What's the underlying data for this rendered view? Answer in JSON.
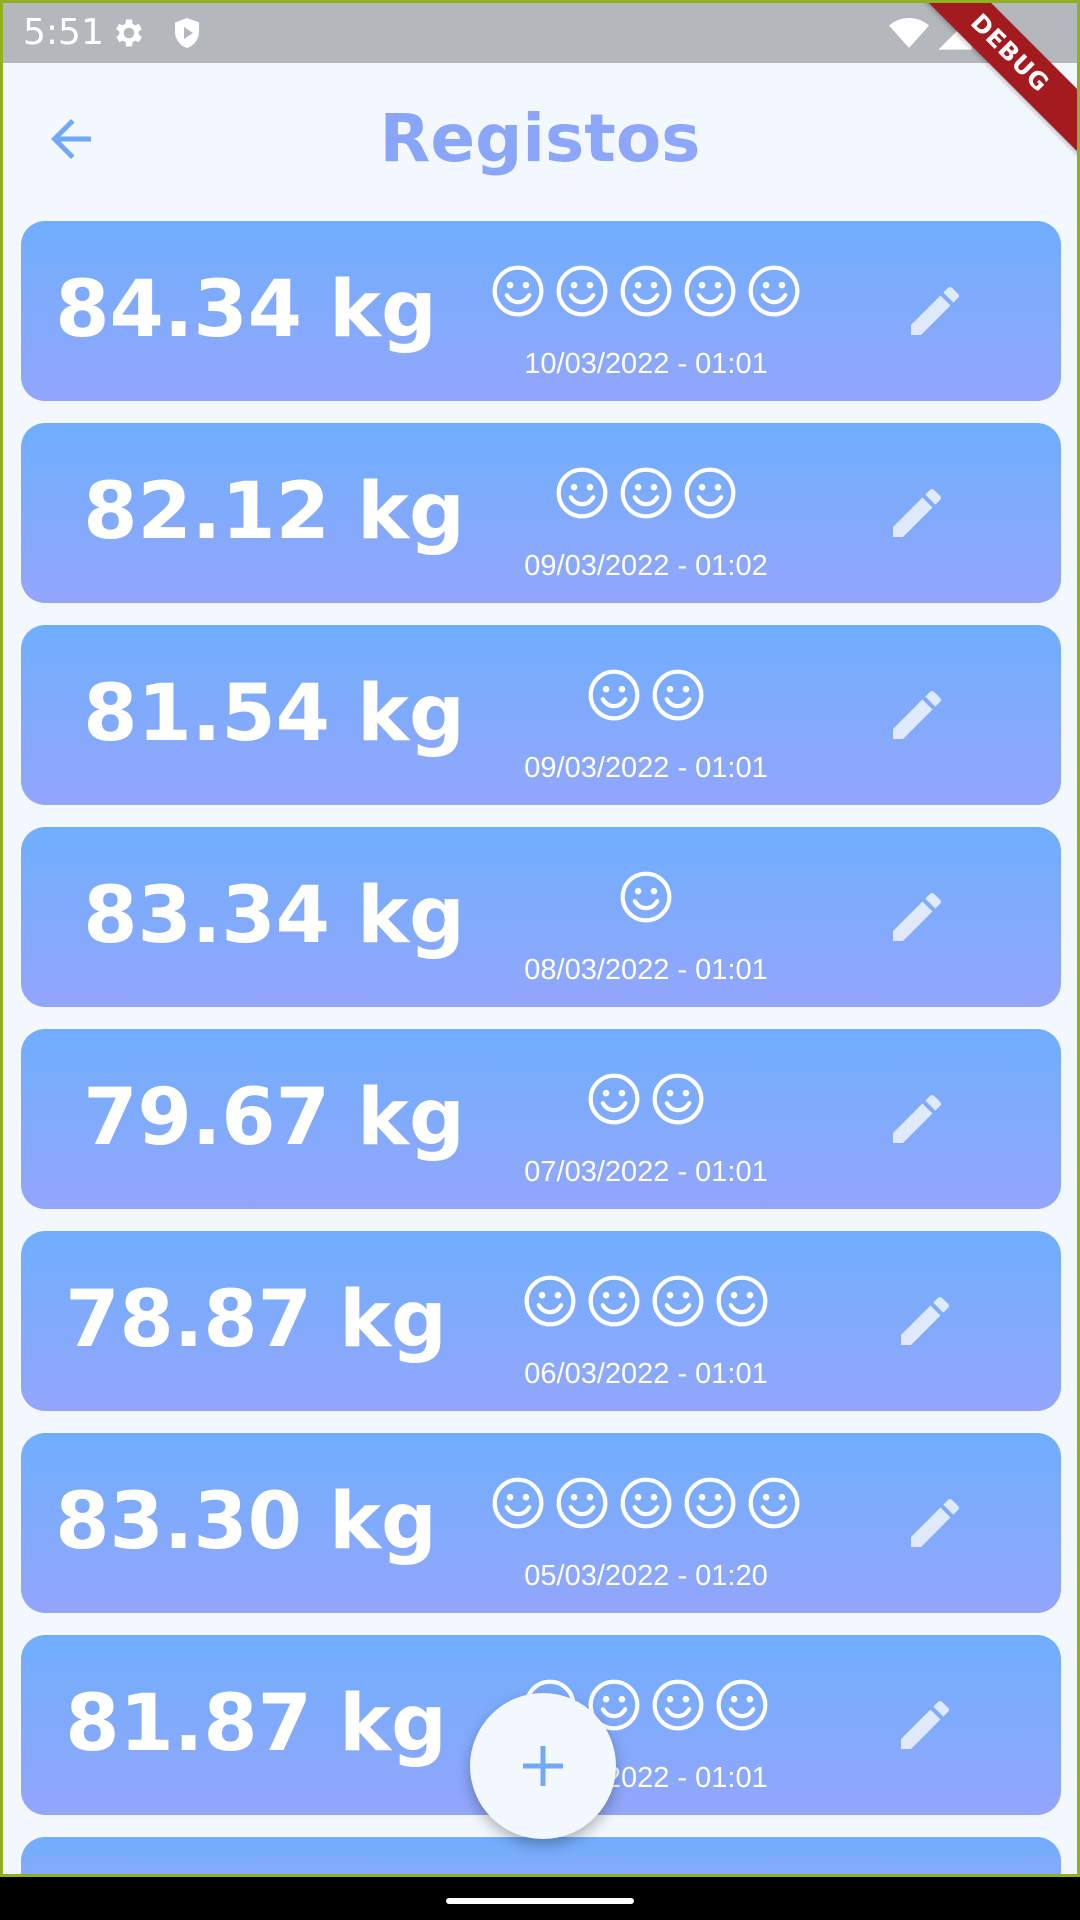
{
  "status_bar": {
    "time": "5:51",
    "icons": [
      "gear-icon",
      "shield-icon",
      "wifi-icon",
      "cell-signal-icon"
    ],
    "debug_banner": "DEBUG"
  },
  "app_bar": {
    "title": "Registos",
    "back_icon": "arrow-back-icon"
  },
  "colors": {
    "accent": "#7fa3f7",
    "card_top": "#70aefd",
    "card_bottom": "#93a6fb",
    "background": "#f3f8fe"
  },
  "records": [
    {
      "weight": "84.34 kg",
      "mood": 5,
      "date": "10/03/2022 - 01:01"
    },
    {
      "weight": "82.12 kg",
      "mood": 3,
      "date": "09/03/2022 - 01:02"
    },
    {
      "weight": "81.54 kg",
      "mood": 2,
      "date": "09/03/2022 - 01:01"
    },
    {
      "weight": "83.34 kg",
      "mood": 1,
      "date": "08/03/2022 - 01:01"
    },
    {
      "weight": "79.67 kg",
      "mood": 2,
      "date": "07/03/2022 - 01:01"
    },
    {
      "weight": "78.87 kg",
      "mood": 4,
      "date": "06/03/2022 - 01:01"
    },
    {
      "weight": "83.30 kg",
      "mood": 5,
      "date": "05/03/2022 - 01:20"
    },
    {
      "weight": "81.87 kg",
      "mood": 4,
      "date": "04/03/2022 - 01:01"
    }
  ],
  "fab": {
    "icon": "plus-icon"
  }
}
